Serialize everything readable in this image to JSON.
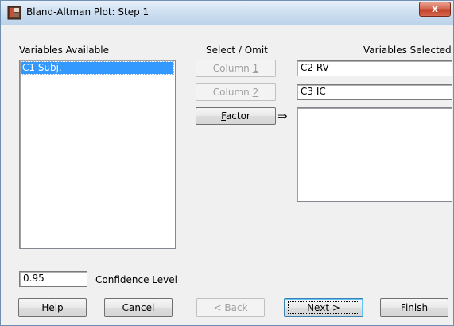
{
  "window": {
    "title": "Bland-Altman Plot: Step 1",
    "close_label": "x"
  },
  "left_panel": {
    "header": "Variables Available",
    "items": [
      "C1 Subj."
    ]
  },
  "middle": {
    "header": "Select / Omit",
    "column1": {
      "prefix": "Column ",
      "accel": "1",
      "suffix": ""
    },
    "column2": {
      "prefix": "Column ",
      "accel": "2",
      "suffix": ""
    },
    "factor": {
      "prefix": "",
      "accel": "F",
      "suffix": "actor"
    },
    "arrow": "⇒"
  },
  "right_panel": {
    "header": "Variables Selected",
    "field1": "C2 RV",
    "field2": "C3 IC",
    "factor_list": []
  },
  "confidence": {
    "value": "0.95",
    "label": "Confidence Level"
  },
  "buttons": {
    "help": {
      "prefix": "",
      "accel": "H",
      "suffix": "elp"
    },
    "cancel": {
      "prefix": "",
      "accel": "C",
      "suffix": "ancel"
    },
    "back": {
      "prefix": "",
      "accel": "< B",
      "suffix": "ack"
    },
    "next": {
      "prefix": "Next ",
      "accel": ">",
      "suffix": ""
    },
    "finish": {
      "prefix": "",
      "accel": "F",
      "suffix": "inish"
    }
  },
  "colors": {
    "selection": "#3399ff",
    "dialog_bg": "#f0f0f0",
    "close_red": "#c2412a"
  }
}
